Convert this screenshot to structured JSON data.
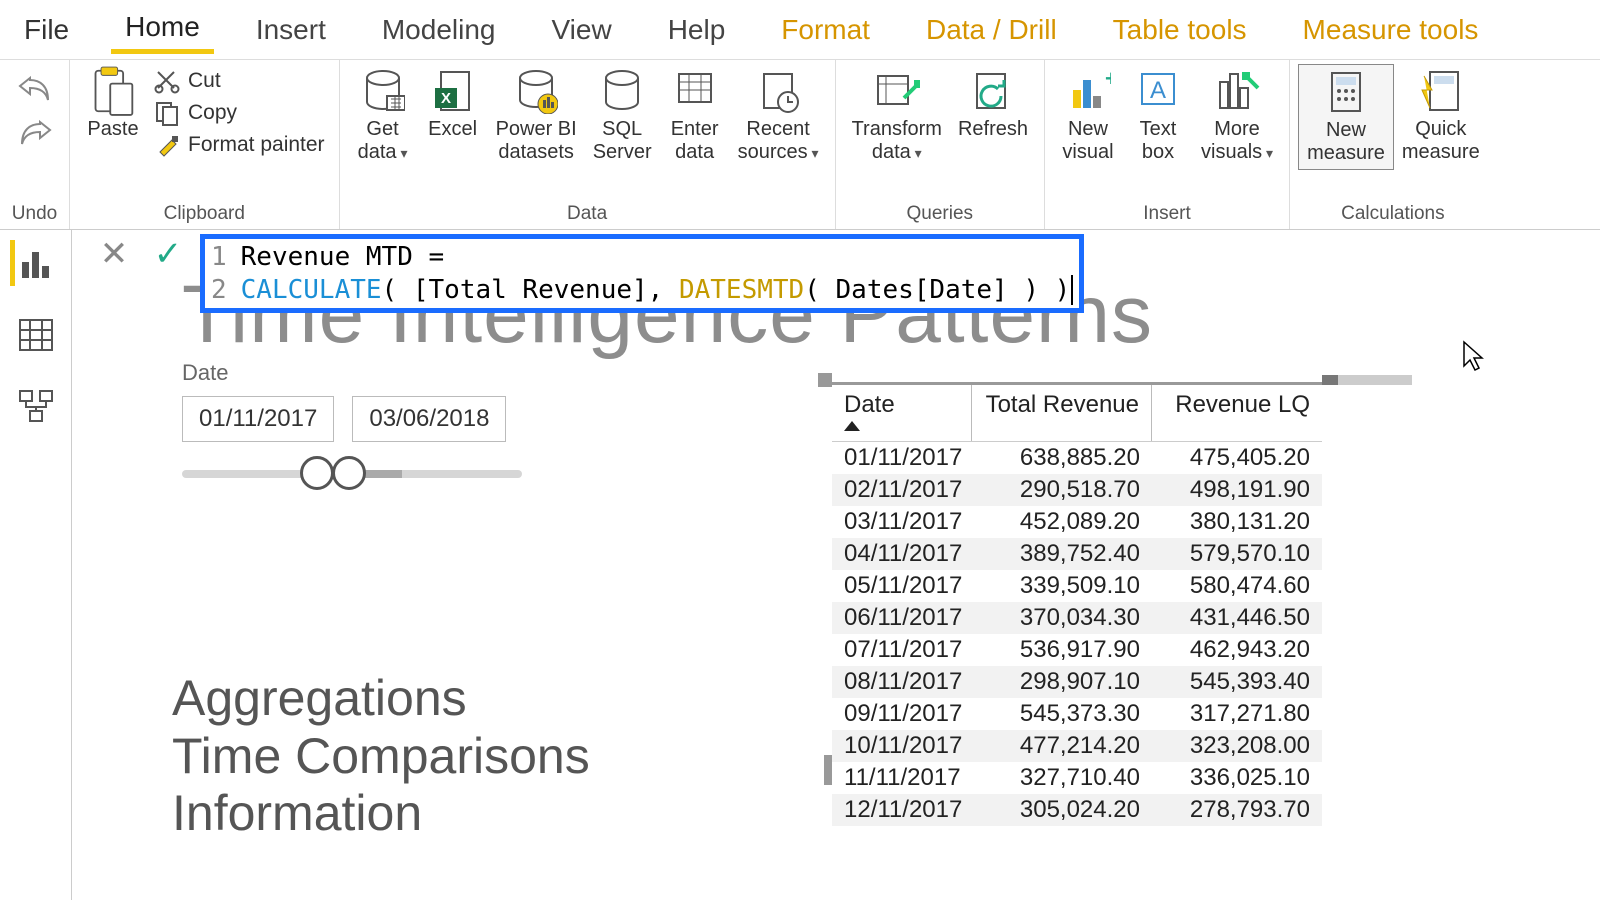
{
  "menu": {
    "file": "File",
    "home": "Home",
    "insert": "Insert",
    "modeling": "Modeling",
    "view": "View",
    "help": "Help",
    "format": "Format",
    "datadrill": "Data / Drill",
    "tabletools": "Table tools",
    "measuretools": "Measure tools"
  },
  "ribbon": {
    "undo_group": "Undo",
    "clipboard_group": "Clipboard",
    "data_group": "Data",
    "queries_group": "Queries",
    "insert_group": "Insert",
    "calc_group": "Calculations",
    "paste": "Paste",
    "cut": "Cut",
    "copy": "Copy",
    "format_painter": "Format painter",
    "get_data": "Get\ndata",
    "excel": "Excel",
    "pbi_datasets": "Power BI\ndatasets",
    "sql_server": "SQL\nServer",
    "enter_data": "Enter\ndata",
    "recent_sources": "Recent\nsources",
    "transform_data": "Transform\ndata",
    "refresh": "Refresh",
    "new_visual": "New\nvisual",
    "text_box": "Text\nbox",
    "more_visuals": "More\nvisuals",
    "new_measure": "New\nmeasure",
    "quick_measure": "Quick\nmeasure"
  },
  "formula": {
    "line1_num": "1",
    "line2_num": "2",
    "line1": "Revenue MTD =",
    "calc": "CALCULATE",
    "mid": "( [Total Revenue], ",
    "fn": "DATESMTD",
    "tail": "( Dates[Date] ) )"
  },
  "page_title_bg": "Time Intelligence Patterns",
  "slicer": {
    "label": "Date",
    "from": "01/11/2017",
    "to": "03/06/2018"
  },
  "bookmarks": {
    "a": "Aggregations",
    "b": "Time Comparisons",
    "c": "Information"
  },
  "table": {
    "headers": {
      "date": "Date",
      "rev": "Total Revenue",
      "lq": "Revenue LQ"
    },
    "rows": [
      {
        "date": "01/11/2017",
        "rev": "638,885.20",
        "lq": "475,405.20"
      },
      {
        "date": "02/11/2017",
        "rev": "290,518.70",
        "lq": "498,191.90"
      },
      {
        "date": "03/11/2017",
        "rev": "452,089.20",
        "lq": "380,131.20"
      },
      {
        "date": "04/11/2017",
        "rev": "389,752.40",
        "lq": "579,570.10"
      },
      {
        "date": "05/11/2017",
        "rev": "339,509.10",
        "lq": "580,474.60"
      },
      {
        "date": "06/11/2017",
        "rev": "370,034.30",
        "lq": "431,446.50"
      },
      {
        "date": "07/11/2017",
        "rev": "536,917.90",
        "lq": "462,943.20"
      },
      {
        "date": "08/11/2017",
        "rev": "298,907.10",
        "lq": "545,393.40"
      },
      {
        "date": "09/11/2017",
        "rev": "545,373.30",
        "lq": "317,271.80"
      },
      {
        "date": "10/11/2017",
        "rev": "477,214.20",
        "lq": "323,208.00"
      },
      {
        "date": "11/11/2017",
        "rev": "327,710.40",
        "lq": "336,025.10"
      },
      {
        "date": "12/11/2017",
        "rev": "305,024.20",
        "lq": "278,793.70"
      }
    ]
  }
}
